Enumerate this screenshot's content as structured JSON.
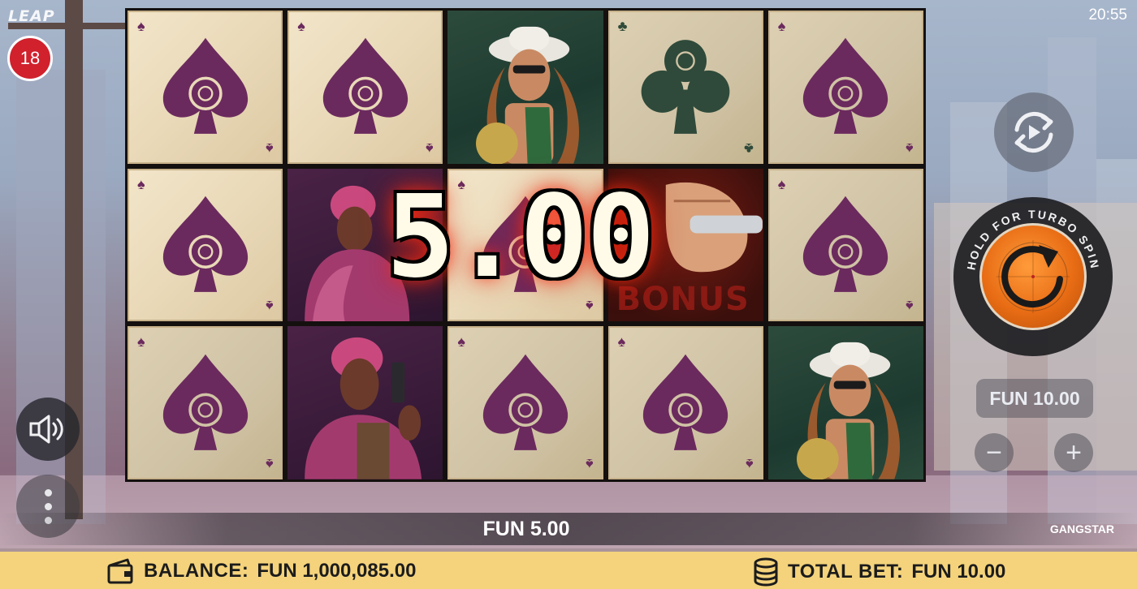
{
  "app": {
    "logo": "LEAP",
    "clock": "20:55",
    "age_badge": "18"
  },
  "reels": [
    [
      "spade",
      "spade",
      "woman-coconut",
      "club",
      "spade"
    ],
    [
      "spade",
      "woman-pink",
      "spade",
      "bonus-fist",
      "spade"
    ],
    [
      "spade",
      "woman-pink-gun",
      "spade",
      "spade",
      "woman-coconut"
    ]
  ],
  "win_overlay": {
    "amount": "5.00"
  },
  "bonus_symbol": {
    "label": "BONUS"
  },
  "controls": {
    "turbo_hint": "HOLD FOR TURBO SPIN",
    "bet_display": "FUN 10.00",
    "minus": "−",
    "plus": "+"
  },
  "win_bar": {
    "amount": "FUN 5.00",
    "game_name": "GANGSTAR"
  },
  "footer": {
    "balance_label": "BALANCE:",
    "balance_value": "FUN 1,000,085.00",
    "total_bet_label": "TOTAL BET:",
    "total_bet_value": "FUN 10.00"
  },
  "icons": [
    "sound-icon",
    "menu-dots-icon",
    "autoplay-icon",
    "spin-icon",
    "wallet-icon",
    "coins-icon"
  ],
  "colors": {
    "spade": "#6b2a5e",
    "club": "#2f4a3a",
    "footer": "#f4d37c",
    "age_badge": "#d0212d",
    "spin": "#e86c14"
  }
}
